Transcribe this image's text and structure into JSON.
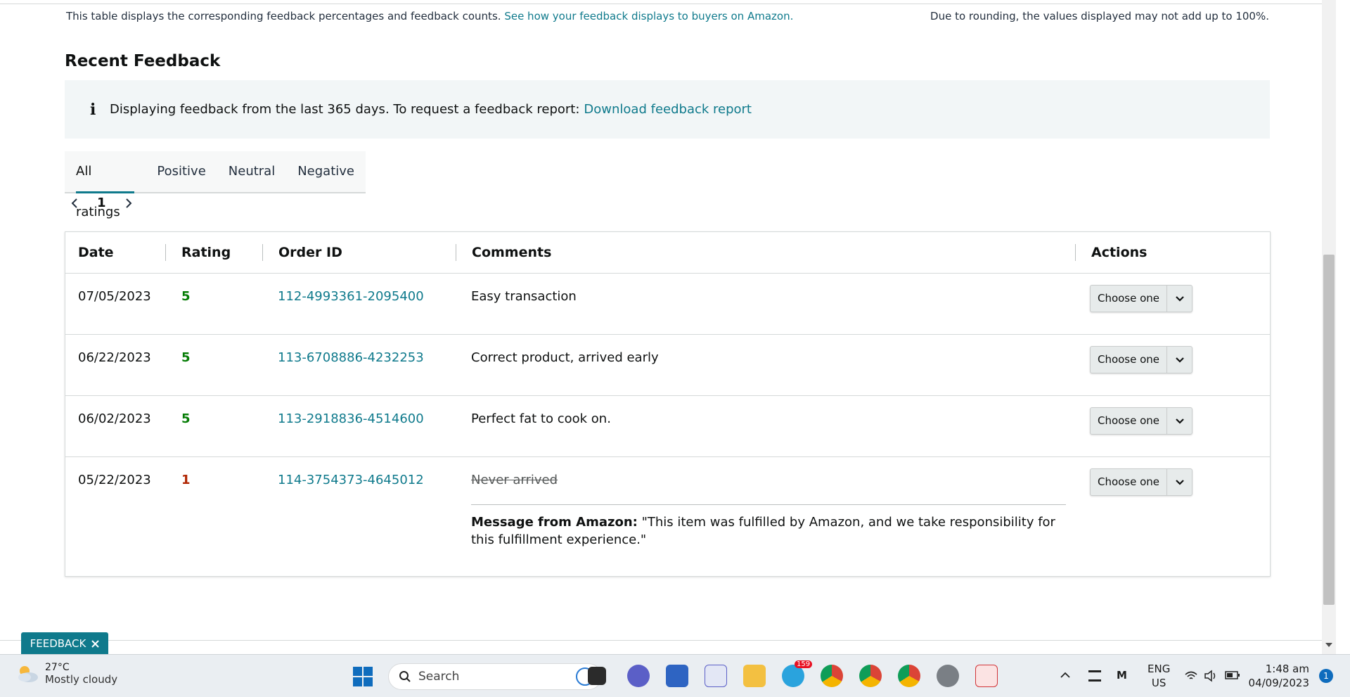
{
  "header": {
    "intro_text": "This table displays the corresponding feedback percentages and feedback counts.",
    "intro_link": "See how your feedback displays to buyers on Amazon.",
    "rounding_note": "Due to rounding, the values displayed may not add up to 100%."
  },
  "recent": {
    "title": "Recent Feedback",
    "info_text": "Displaying feedback from the last 365 days. To request a feedback report:",
    "info_link": "Download feedback report",
    "tabs": [
      "All ratings",
      "Positive",
      "Neutral",
      "Negative"
    ],
    "active_tab": "All ratings",
    "page": "1"
  },
  "table": {
    "columns": [
      "Date",
      "Rating",
      "Order ID",
      "Comments",
      "Actions"
    ],
    "action_label": "Choose one",
    "rows": [
      {
        "date": "07/05/2023",
        "rating": "5",
        "order_id": "112-4993361-2095400",
        "comment": "Easy transaction"
      },
      {
        "date": "06/22/2023",
        "rating": "5",
        "order_id": "113-6708886-4232253",
        "comment": "Correct product, arrived early"
      },
      {
        "date": "06/02/2023",
        "rating": "5",
        "order_id": "113-2918836-4514600",
        "comment": "Perfect fat to cook on."
      },
      {
        "date": "05/22/2023",
        "rating": "1",
        "order_id": "114-3754373-4645012",
        "comment": "Never arrived"
      }
    ],
    "message_label": "Message from Amazon:",
    "message_text": "\"This item was fulfilled by Amazon, and we take responsibility for this fulfillment experience.\""
  },
  "feedback_tab": {
    "label": "FEEDBACK"
  },
  "taskbar": {
    "temperature": "27°C",
    "weather": "Mostly cloudy",
    "search_placeholder": "Search",
    "telegram_badge": "159",
    "lang_top": "ENG",
    "lang_bottom": "US",
    "time": "1:48 am",
    "date": "04/09/2023",
    "notifications": "1"
  },
  "colors": {
    "link": "#0f7a8c",
    "positive": "#067d06",
    "negative": "#b12704"
  }
}
